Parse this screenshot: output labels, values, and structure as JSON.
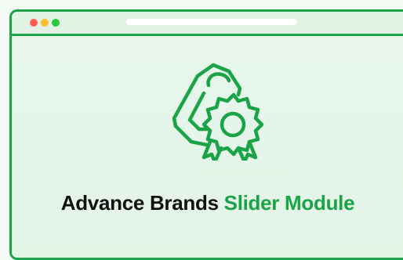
{
  "window": {
    "traffic_lights": [
      "close",
      "minimize",
      "maximize"
    ],
    "colors": {
      "frame": "#1aa447",
      "close": "#ff5f57",
      "minimize": "#febc2e",
      "maximize": "#28c840"
    }
  },
  "hero": {
    "icon": "brand-tag-badge-icon",
    "title_primary": "Advance Brands",
    "title_accent": "Slider Module"
  }
}
